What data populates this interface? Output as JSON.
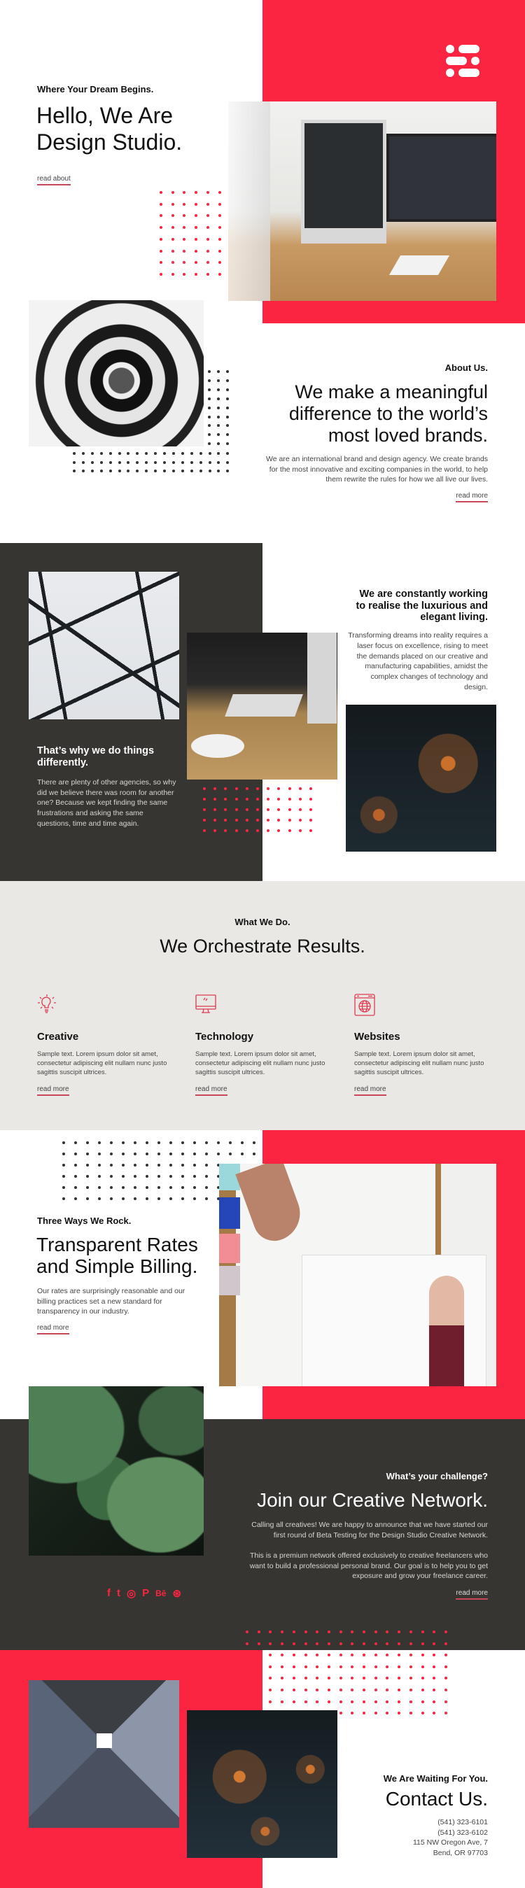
{
  "colors": {
    "accent": "#fb2541",
    "dark": "#363531",
    "light_gray": "#e9e8e4"
  },
  "logo": {
    "icon": "dots-logo-icon"
  },
  "hero": {
    "kicker": "Where Your Dream Begins.",
    "title_line1": "Hello, We Are",
    "title_line2": "Design Studio.",
    "link": "read about"
  },
  "about": {
    "kicker": "About Us.",
    "title_line1": "We make a meaningful",
    "title_line2": "difference to the world’s",
    "title_line3": "most loved brands.",
    "body": "We are an international brand and design agency. We create brands for the most innovative and exciting companies in the world, to help them rewrite the rules for how we all live our lives.",
    "link": "read more"
  },
  "working": {
    "title": "We are constantly working to realise the luxurious and elegant living.",
    "body": "Transforming dreams into reality requires a laser focus on excellence, rising to meet the demands placed on our creative and manufacturing capabilities, amidst the complex changes of technology and design."
  },
  "different": {
    "title": "That’s why we do things differently.",
    "body": "There are plenty of other agencies, so why did we believe there was room for another one? Because we kept finding the same frustrations and asking the same questions, time and time again."
  },
  "services": {
    "kicker": "What We Do.",
    "title": "We Orchestrate Results.",
    "items": [
      {
        "icon": "lightbulb-icon",
        "title": "Creative",
        "body": "Sample text. Lorem ipsum dolor sit amet, consectetur adipiscing elit nullam nunc justo sagittis suscipit ultrices.",
        "link": "read more"
      },
      {
        "icon": "monitor-icon",
        "title": "Technology",
        "body": "Sample text. Lorem ipsum dolor sit amet, consectetur adipiscing elit nullam nunc justo sagittis suscipit ultrices.",
        "link": "read more"
      },
      {
        "icon": "globe-browser-icon",
        "title": "Websites",
        "body": "Sample text. Lorem ipsum dolor sit amet, consectetur adipiscing elit nullam nunc justo sagittis suscipit ultrices.",
        "link": "read more"
      }
    ]
  },
  "billing": {
    "kicker": "Three Ways We Rock.",
    "title_line1": "Transparent Rates",
    "title_line2": "and Simple Billing.",
    "body": "Our rates are surprisingly reasonable and our billing practices set a new standard for transparency in our industry.",
    "link": "read more"
  },
  "network": {
    "kicker": "What’s your challenge?",
    "title": "Join our Creative Network.",
    "body1": "Calling all creatives! We are happy to announce that we have started our first round of Beta Testing for the Design Studio Creative Network.",
    "body2": "This is a premium network offered exclusively to creative freelancers who want to build a professional personal brand. Our goal is to help you to get exposure and grow your freelance career.",
    "link": "read more",
    "social": [
      {
        "icon": "facebook-icon",
        "glyph": "f"
      },
      {
        "icon": "twitter-icon",
        "glyph": "t"
      },
      {
        "icon": "instagram-icon",
        "glyph": "◎"
      },
      {
        "icon": "pinterest-icon",
        "glyph": "P"
      },
      {
        "icon": "behance-icon",
        "glyph": "Bē"
      },
      {
        "icon": "dribbble-icon",
        "glyph": "⊛"
      }
    ]
  },
  "contact": {
    "kicker": "We Are Waiting For You.",
    "title": "Contact Us.",
    "phone1": "(541) 323-6101",
    "phone2": "(541) 323-6102",
    "address1": "115 NW Oregon Ave, 7",
    "address2": "Bend, OR 97703"
  }
}
